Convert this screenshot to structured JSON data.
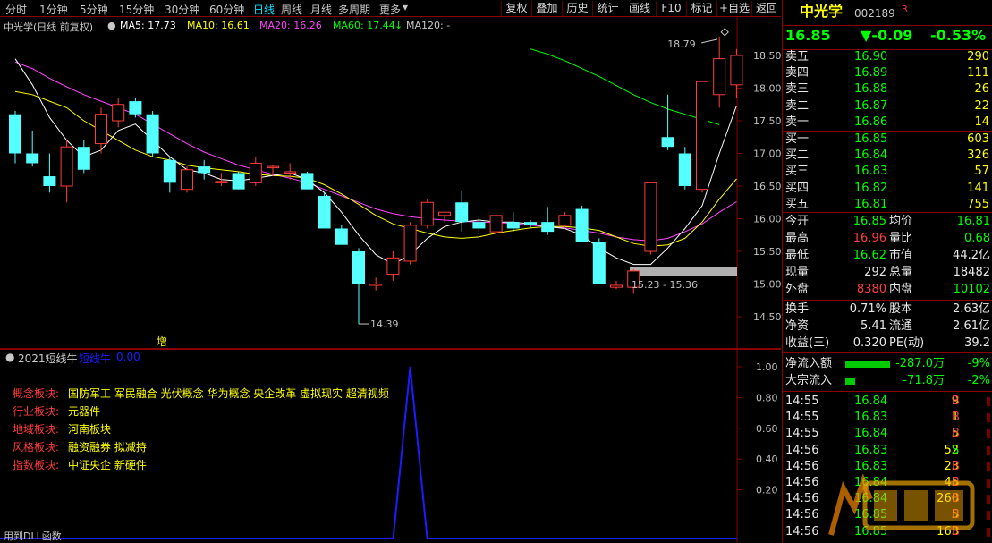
{
  "toolbar": {
    "periods": [
      "分时",
      "1分钟",
      "5分钟",
      "15分钟",
      "30分钟",
      "60分钟",
      "日线",
      "周线",
      "月线",
      "多周期",
      "更多"
    ],
    "active_period": "日线",
    "buttons": [
      "复权",
      "叠加",
      "历史",
      "统计",
      "画线",
      "F10",
      "标记",
      "+自选",
      "返回"
    ]
  },
  "chart_header": {
    "title": "中光学(日线 前复权)",
    "ma5": "MA5: 17.73",
    "ma10": "MA10: 16.61",
    "ma20": "MA20: 16.26",
    "ma60": "MA60: 17.44",
    "ma60_arrow": "↓",
    "ma120": "MA120: -"
  },
  "colors": {
    "up": "#ff3c3c",
    "down": "#54ffff",
    "ma5": "#ffffff",
    "ma10": "#ffff00",
    "ma20": "#ff44ff",
    "ma60": "#00ff00",
    "indicator": "#1c1cff",
    "grid": "#8b0000"
  },
  "chart_data": {
    "type": "candlestick",
    "y_ticks": [
      "18.50",
      "18.00",
      "17.50",
      "17.00",
      "16.50",
      "16.00",
      "15.50",
      "15.00",
      "14.50"
    ],
    "ylim": [
      14.3,
      19.0
    ],
    "candles": [
      {
        "o": 17.6,
        "h": 17.65,
        "l": 16.85,
        "c": 17.0
      },
      {
        "o": 17.0,
        "h": 17.35,
        "l": 16.8,
        "c": 16.85
      },
      {
        "o": 16.65,
        "h": 17.0,
        "l": 16.4,
        "c": 16.5
      },
      {
        "o": 16.5,
        "h": 17.2,
        "l": 16.25,
        "c": 17.1
      },
      {
        "o": 17.1,
        "h": 17.2,
        "l": 16.7,
        "c": 16.75
      },
      {
        "o": 17.15,
        "h": 17.7,
        "l": 17.0,
        "c": 17.6
      },
      {
        "o": 17.5,
        "h": 17.85,
        "l": 17.4,
        "c": 17.75
      },
      {
        "o": 17.8,
        "h": 17.85,
        "l": 17.55,
        "c": 17.6
      },
      {
        "o": 17.6,
        "h": 17.65,
        "l": 16.95,
        "c": 17.0
      },
      {
        "o": 16.9,
        "h": 16.95,
        "l": 16.4,
        "c": 16.55
      },
      {
        "o": 16.45,
        "h": 16.8,
        "l": 16.4,
        "c": 16.75
      },
      {
        "o": 16.8,
        "h": 16.9,
        "l": 16.6,
        "c": 16.7
      },
      {
        "o": 16.55,
        "h": 16.7,
        "l": 16.5,
        "c": 16.57
      },
      {
        "o": 16.7,
        "h": 16.72,
        "l": 16.45,
        "c": 16.45
      },
      {
        "o": 16.55,
        "h": 16.95,
        "l": 16.5,
        "c": 16.85
      },
      {
        "o": 16.8,
        "h": 16.82,
        "l": 16.65,
        "c": 16.8
      },
      {
        "o": 16.7,
        "h": 16.85,
        "l": 16.6,
        "c": 16.72
      },
      {
        "o": 16.7,
        "h": 16.72,
        "l": 16.45,
        "c": 16.45
      },
      {
        "o": 16.35,
        "h": 16.4,
        "l": 15.85,
        "c": 15.85
      },
      {
        "o": 15.85,
        "h": 15.9,
        "l": 15.6,
        "c": 15.6
      },
      {
        "o": 15.5,
        "h": 15.55,
        "l": 14.39,
        "c": 15.0
      },
      {
        "o": 15.0,
        "h": 15.1,
        "l": 14.9,
        "c": 15.0
      },
      {
        "o": 15.15,
        "h": 15.5,
        "l": 15.05,
        "c": 15.4
      },
      {
        "o": 15.35,
        "h": 15.95,
        "l": 15.3,
        "c": 15.9
      },
      {
        "o": 15.9,
        "h": 16.3,
        "l": 15.85,
        "c": 16.25
      },
      {
        "o": 16.05,
        "h": 16.1,
        "l": 15.95,
        "c": 16.1
      },
      {
        "o": 16.25,
        "h": 16.42,
        "l": 15.8,
        "c": 15.95
      },
      {
        "o": 15.95,
        "h": 16.05,
        "l": 15.75,
        "c": 15.85
      },
      {
        "o": 15.8,
        "h": 16.08,
        "l": 15.78,
        "c": 16.05
      },
      {
        "o": 15.95,
        "h": 16.1,
        "l": 15.8,
        "c": 15.85
      },
      {
        "o": 15.95,
        "h": 15.98,
        "l": 15.85,
        "c": 15.9
      },
      {
        "o": 15.95,
        "h": 16.18,
        "l": 15.75,
        "c": 15.8
      },
      {
        "o": 15.9,
        "h": 16.1,
        "l": 15.85,
        "c": 16.05
      },
      {
        "o": 16.15,
        "h": 16.2,
        "l": 15.65,
        "c": 15.65
      },
      {
        "o": 15.65,
        "h": 15.7,
        "l": 15.0,
        "c": 15.0
      },
      {
        "o": 14.95,
        "h": 15.05,
        "l": 14.92,
        "c": 14.98
      },
      {
        "o": 14.95,
        "h": 15.23,
        "l": 14.85,
        "c": 15.2
      },
      {
        "o": 15.5,
        "h": 16.55,
        "l": 15.45,
        "c": 16.55
      },
      {
        "o": 17.25,
        "h": 17.9,
        "l": 17.05,
        "c": 17.1
      },
      {
        "o": 17.0,
        "h": 17.1,
        "l": 16.45,
        "c": 16.5
      },
      {
        "o": 16.45,
        "h": 18.1,
        "l": 16.4,
        "c": 18.1
      },
      {
        "o": 17.9,
        "h": 18.79,
        "l": 17.7,
        "c": 18.45
      },
      {
        "o": 18.05,
        "h": 18.6,
        "l": 17.85,
        "c": 18.5
      }
    ],
    "ma5": [
      18.45,
      18.05,
      17.55,
      17.2,
      16.95,
      17.05,
      17.35,
      17.45,
      17.2,
      16.95,
      16.75,
      16.7,
      16.6,
      16.58,
      16.62,
      16.66,
      16.7,
      16.6,
      16.4,
      16.1,
      15.75,
      15.45,
      15.3,
      15.45,
      15.7,
      15.88,
      15.95,
      15.98,
      15.95,
      15.95,
      15.92,
      15.88,
      15.85,
      15.75,
      15.55,
      15.4,
      15.3,
      15.3,
      15.55,
      15.85,
      16.2,
      17.0,
      17.73
    ],
    "ma10": [
      17.95,
      17.9,
      17.8,
      17.7,
      17.5,
      17.35,
      17.2,
      17.05,
      16.95,
      16.9,
      16.82,
      16.78,
      16.75,
      16.72,
      16.68,
      16.66,
      16.65,
      16.62,
      16.52,
      16.38,
      16.22,
      16.05,
      15.92,
      15.85,
      15.78,
      15.72,
      15.7,
      15.72,
      15.78,
      15.82,
      15.86,
      15.88,
      15.88,
      15.86,
      15.82,
      15.72,
      15.62,
      15.58,
      15.6,
      15.7,
      15.95,
      16.3,
      16.61
    ],
    "ma20": [
      18.4,
      18.3,
      18.15,
      18.02,
      17.9,
      17.8,
      17.7,
      17.6,
      17.45,
      17.3,
      17.15,
      17.02,
      16.92,
      16.82,
      16.75,
      16.68,
      16.62,
      16.55,
      16.45,
      16.35,
      16.25,
      16.15,
      16.08,
      16.03,
      16.0,
      15.98,
      15.96,
      15.95,
      15.94,
      15.93,
      15.9,
      15.88,
      15.86,
      15.82,
      15.78,
      15.72,
      15.68,
      15.66,
      15.7,
      15.8,
      15.92,
      16.1,
      16.26
    ],
    "ma60_start_index": 30,
    "ma60": [
      18.6,
      18.52,
      18.42,
      18.3,
      18.18,
      18.04,
      17.9,
      17.78,
      17.68,
      17.6,
      17.52,
      17.44
    ],
    "annotations": {
      "high_label": "18.79",
      "low_label": "14.39",
      "range_label": "15.23 - 15.36",
      "zeng_label": "增"
    }
  },
  "indicator": {
    "title": "2021短线牛",
    "series_name": "短线牛",
    "value": "0.00",
    "y_ticks": [
      "1.00",
      "0.80",
      "0.60",
      "0.40",
      "0.20"
    ],
    "ylim": [
      0,
      1.0
    ],
    "spike_index": 23,
    "footer": "用到DLL函数",
    "info": [
      {
        "label": "概念板块:",
        "value": "国防军工 军民融合 光伏概念 华为概念 央企改革 虚拟现实 超清视频"
      },
      {
        "label": "行业板块:",
        "value": "元器件"
      },
      {
        "label": "地域板块:",
        "value": "河南板块"
      },
      {
        "label": "风格板块:",
        "value": "融资融券 拟减持"
      },
      {
        "label": "指数板块:",
        "value": "中证央企 新硬件"
      }
    ]
  },
  "quote": {
    "name": "中光学",
    "code": "002189",
    "flag": "R",
    "price": "16.85",
    "change": "▼-0.09",
    "change_pct": "-0.53%",
    "asks": [
      {
        "label": "卖五",
        "price": "16.90",
        "vol": "290"
      },
      {
        "label": "卖四",
        "price": "16.89",
        "vol": "111"
      },
      {
        "label": "卖三",
        "price": "16.88",
        "vol": "26"
      },
      {
        "label": "卖二",
        "price": "16.87",
        "vol": "22"
      },
      {
        "label": "卖一",
        "price": "16.86",
        "vol": "14"
      }
    ],
    "bids": [
      {
        "label": "买一",
        "price": "16.85",
        "vol": "603"
      },
      {
        "label": "买二",
        "price": "16.84",
        "vol": "326"
      },
      {
        "label": "买三",
        "price": "16.83",
        "vol": "57"
      },
      {
        "label": "买四",
        "price": "16.82",
        "vol": "141"
      },
      {
        "label": "买五",
        "price": "16.81",
        "vol": "755"
      }
    ],
    "stats": [
      {
        "l1": "今开",
        "v1": "16.85",
        "c1": "green",
        "l2": "均价",
        "v2": "16.81",
        "c2": "green"
      },
      {
        "l1": "最高",
        "v1": "16.96",
        "c1": "red",
        "l2": "量比",
        "v2": "0.68",
        "c2": "green"
      },
      {
        "l1": "最低",
        "v1": "16.62",
        "c1": "green",
        "l2": "市值",
        "v2": "44.2亿",
        "c2": "white"
      },
      {
        "l1": "现量",
        "v1": "292",
        "c1": "white",
        "l2": "总量",
        "v2": "18482",
        "c2": "white"
      },
      {
        "l1": "外盘",
        "v1": "8380",
        "c1": "red",
        "l2": "内盘",
        "v2": "10102",
        "c2": "green"
      }
    ],
    "stats2": [
      {
        "l1": "换手",
        "v1": "0.71%",
        "l2": "股本",
        "v2": "2.63亿"
      },
      {
        "l1": "净资",
        "v1": "5.41",
        "l2": "流通",
        "v2": "2.61亿"
      },
      {
        "l1": "收益(三)",
        "v1": "0.320",
        "l2": "PE(动)",
        "v2": "39.2"
      }
    ],
    "flows": [
      {
        "label": "净流入额",
        "amount": "-287.0万",
        "pct": "-9%",
        "bar": 0.9
      },
      {
        "label": "大宗流入",
        "amount": "-71.8万",
        "pct": "-2%",
        "bar": 0.2
      }
    ],
    "ticks": [
      {
        "t": "14:55",
        "p": "16.84",
        "v": "9",
        "d": "B"
      },
      {
        "t": "14:55",
        "p": "16.83",
        "v": "1",
        "d": "B"
      },
      {
        "t": "14:55",
        "p": "16.84",
        "v": "5",
        "d": "B"
      },
      {
        "t": "14:56",
        "p": "16.83",
        "v": "52",
        "d": "S"
      },
      {
        "t": "14:56",
        "p": "16.83",
        "v": "23",
        "d": "B"
      },
      {
        "t": "14:56",
        "p": "16.84",
        "v": "45",
        "d": "B"
      },
      {
        "t": "14:56",
        "p": "16.84",
        "v": "260",
        "d": "B"
      },
      {
        "t": "14:56",
        "p": "16.85",
        "v": "5",
        "d": "B"
      },
      {
        "t": "14:56",
        "p": "16.85",
        "v": "163",
        "d": "B"
      }
    ]
  }
}
